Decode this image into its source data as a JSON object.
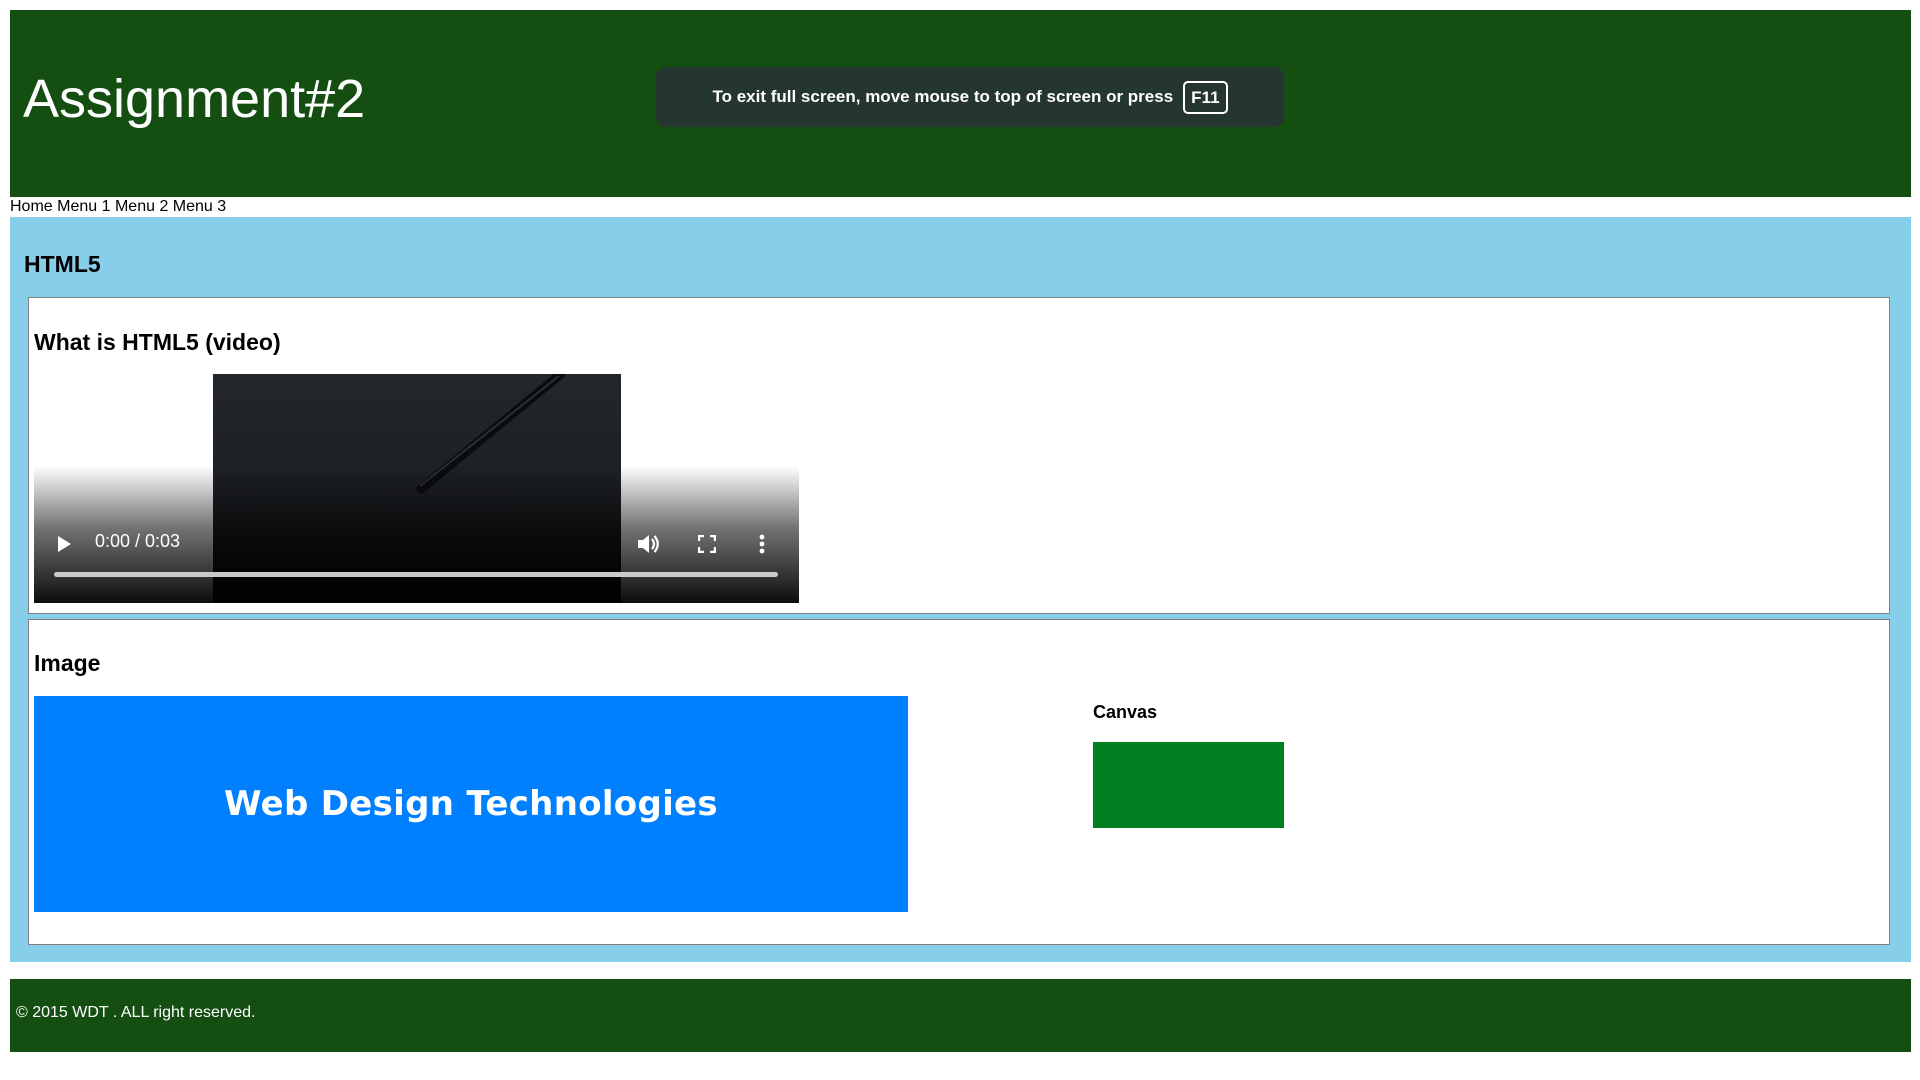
{
  "header": {
    "title": "Assignment#2"
  },
  "fullscreen_notice": {
    "message": "To exit full screen, move mouse to top of screen or press",
    "key": "F11"
  },
  "nav": {
    "items": [
      "Home",
      "Menu 1",
      "Menu 2",
      "Menu 3"
    ]
  },
  "main": {
    "heading": "HTML5",
    "video_section": {
      "heading": "What is HTML5 (video)",
      "video": {
        "time": "0:00 / 0:03",
        "progress": 0,
        "icons": [
          "play-icon",
          "volume-icon",
          "fullscreen-icon",
          "more-options-icon"
        ]
      }
    },
    "image_section": {
      "heading": "Image",
      "banner_text": "Web Design Technologies",
      "banner_color": "#007fff",
      "canvas_label": "Canvas",
      "canvas_fill": "#008020"
    }
  },
  "footer": {
    "text": "© 2015 WDT . ALL right reserved."
  },
  "colors": {
    "header_bg": "#154e11",
    "main_bg": "#87ceeb",
    "footer_bg": "#154e11"
  }
}
